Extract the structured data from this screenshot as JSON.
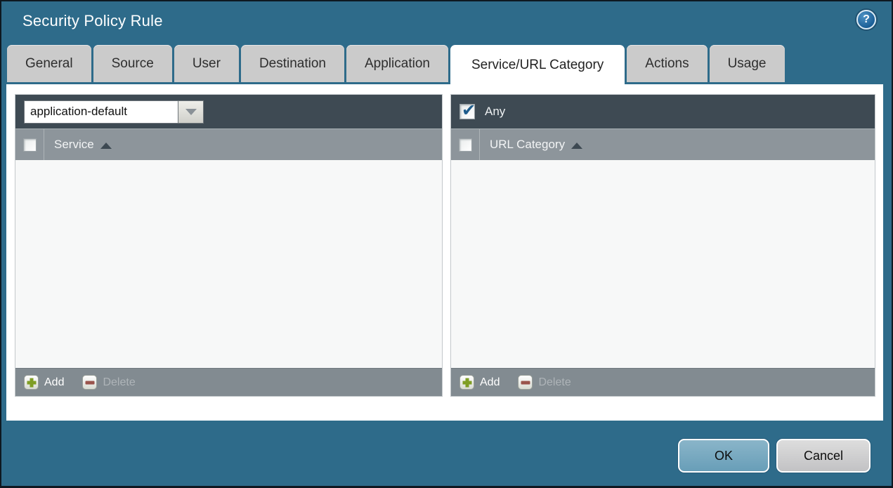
{
  "window": {
    "title": "Security Policy Rule"
  },
  "help": {
    "glyph": "?"
  },
  "tabs": [
    {
      "label": "General",
      "active": false
    },
    {
      "label": "Source",
      "active": false
    },
    {
      "label": "User",
      "active": false
    },
    {
      "label": "Destination",
      "active": false
    },
    {
      "label": "Application",
      "active": false
    },
    {
      "label": "Service/URL Category",
      "active": true
    },
    {
      "label": "Actions",
      "active": false
    },
    {
      "label": "Usage",
      "active": false
    }
  ],
  "service_panel": {
    "dropdown": {
      "value": "application-default"
    },
    "header": {
      "label": "Service",
      "checkbox_checked": false,
      "sort": "asc"
    },
    "rows": [],
    "toolbar": {
      "add_label": "Add",
      "delete_label": "Delete",
      "delete_enabled": false
    }
  },
  "url_category_panel": {
    "any_checkbox": {
      "label": "Any",
      "checked": true
    },
    "header": {
      "label": "URL Category",
      "checkbox_checked": false,
      "sort": "asc"
    },
    "rows": [],
    "toolbar": {
      "add_label": "Add",
      "delete_label": "Delete",
      "delete_enabled": false
    }
  },
  "actions": {
    "ok_label": "OK",
    "cancel_label": "Cancel"
  },
  "colors": {
    "titlebar_background": "#2e6b8a",
    "panel_dark_bar": "#3e4a53",
    "column_header": "#8d959b",
    "toolbar_bar": "#828b91",
    "active_tab": "#ffffff",
    "inactive_tab": "#cbcbcb",
    "ok_button": "#72a6bf",
    "add_icon_green": "#7f9e24",
    "delete_icon_red": "#9a544c",
    "check_blue": "#1e5c8c"
  }
}
